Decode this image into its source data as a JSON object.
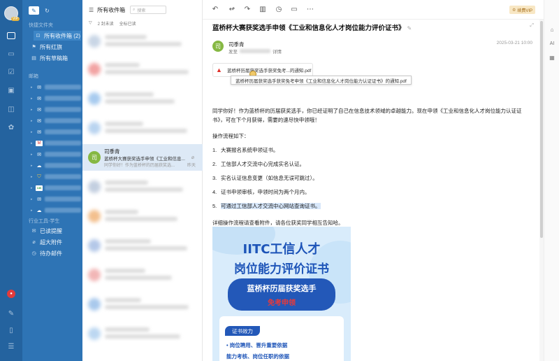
{
  "rail": {
    "avatar_badge": "VIP",
    "icons": [
      "mail-icon",
      "folder-icon",
      "task-icon",
      "contacts-icon",
      "ai-icon",
      "apps-icon"
    ],
    "bottom_icons": [
      "app-badge-icon",
      "notes-icon",
      "mobile-icon",
      "menu-icon"
    ]
  },
  "folders": {
    "quick_title": "快捷文件夹",
    "quick_items": [
      {
        "label": "所有收件箱 (2)",
        "icon": "inbox-icon",
        "selected": true
      },
      {
        "label": "所有红旗",
        "icon": "flag-icon",
        "selected": false
      },
      {
        "label": "所有草稿箱",
        "icon": "draft-icon",
        "selected": false
      }
    ],
    "mailbox_title": "邮箱",
    "tools_title": "行业工具-学生",
    "tool_items": [
      {
        "label": "已读提醒",
        "icon": "read-receipt-icon"
      },
      {
        "label": "超大附件",
        "icon": "attachment-icon"
      },
      {
        "label": "待办邮件",
        "icon": "todo-icon"
      }
    ]
  },
  "list": {
    "title": "所有收件箱",
    "search_placeholder": "搜索",
    "filter_count": "2 封未读",
    "filter_mark": "全标已读",
    "selected": {
      "avatar": "司",
      "sender": "司季青",
      "subject": "蓝桥杯大赛获奖选手申领《工业和信息...",
      "preview": "同学你好！作为蓝桥杯的历届获奖选...",
      "time": "昨天"
    }
  },
  "reader": {
    "vip_label": "续费VIP",
    "subject": "蓝桥杯大赛获奖选手申领《工业和信息化人才岗位能力评价证书》",
    "sender_avatar": "司",
    "sender": "司季青",
    "to_label": "发至",
    "details_label": "详情",
    "time": "2025-03-21 10:00",
    "attachment_name": "蓝桥杯历届获奖选手获奖免考...的通知.pdf",
    "attachment_tooltip": "蓝桥杯历届获奖选手获奖免考申领《工业和信息化人才岗位能力认证证书》的通知.pdf",
    "greeting": "同学你好！作为蓝桥杯的历届获奖选手，你已经证明了自己在信息技术领域的卓越能力。现在申领《工业和信息化人才岗位能力认证证书》，可在下个月获得，需要的速尽快申领哦！",
    "op_title": "操作流程如下：",
    "steps": [
      {
        "num": "1.",
        "text": "大赛报名系统申领证书。"
      },
      {
        "num": "2.",
        "text": "工信部人才交流中心完成实名认证。"
      },
      {
        "num": "3.",
        "text": "实名认证信息变更（如信息无误可跳过）。"
      },
      {
        "num": "4.",
        "text": "证书申领审核，申领时间为两个月内。"
      },
      {
        "num": "5.",
        "text": "可通过工信部人才交流中心网站查询证书。"
      }
    ],
    "detail_note": "详细操作流程请查看附件，请各位获奖同学相互告知哈。",
    "poster": {
      "title1": "IITC工信人才",
      "title2": "岗位能力评价证书",
      "banner1": "蓝桥杯历届获奖选手",
      "banner2": "免考申领",
      "tag": "证书效力",
      "line1": "• 岗位聘用、晋升重要依据",
      "line2": "能力考核、岗位任职的依据"
    }
  },
  "right_rail": {
    "icons": [
      "home-icon",
      "ai-assistant-icon",
      "calendar-icon"
    ],
    "labels": [
      "AI"
    ]
  },
  "colors": {
    "rail_bg": "#24639f",
    "folder_bg": "#2e74b5",
    "selected_row": "#dde9f6",
    "avatar_green": "#86b843",
    "poster_blue": "#2358b8"
  }
}
